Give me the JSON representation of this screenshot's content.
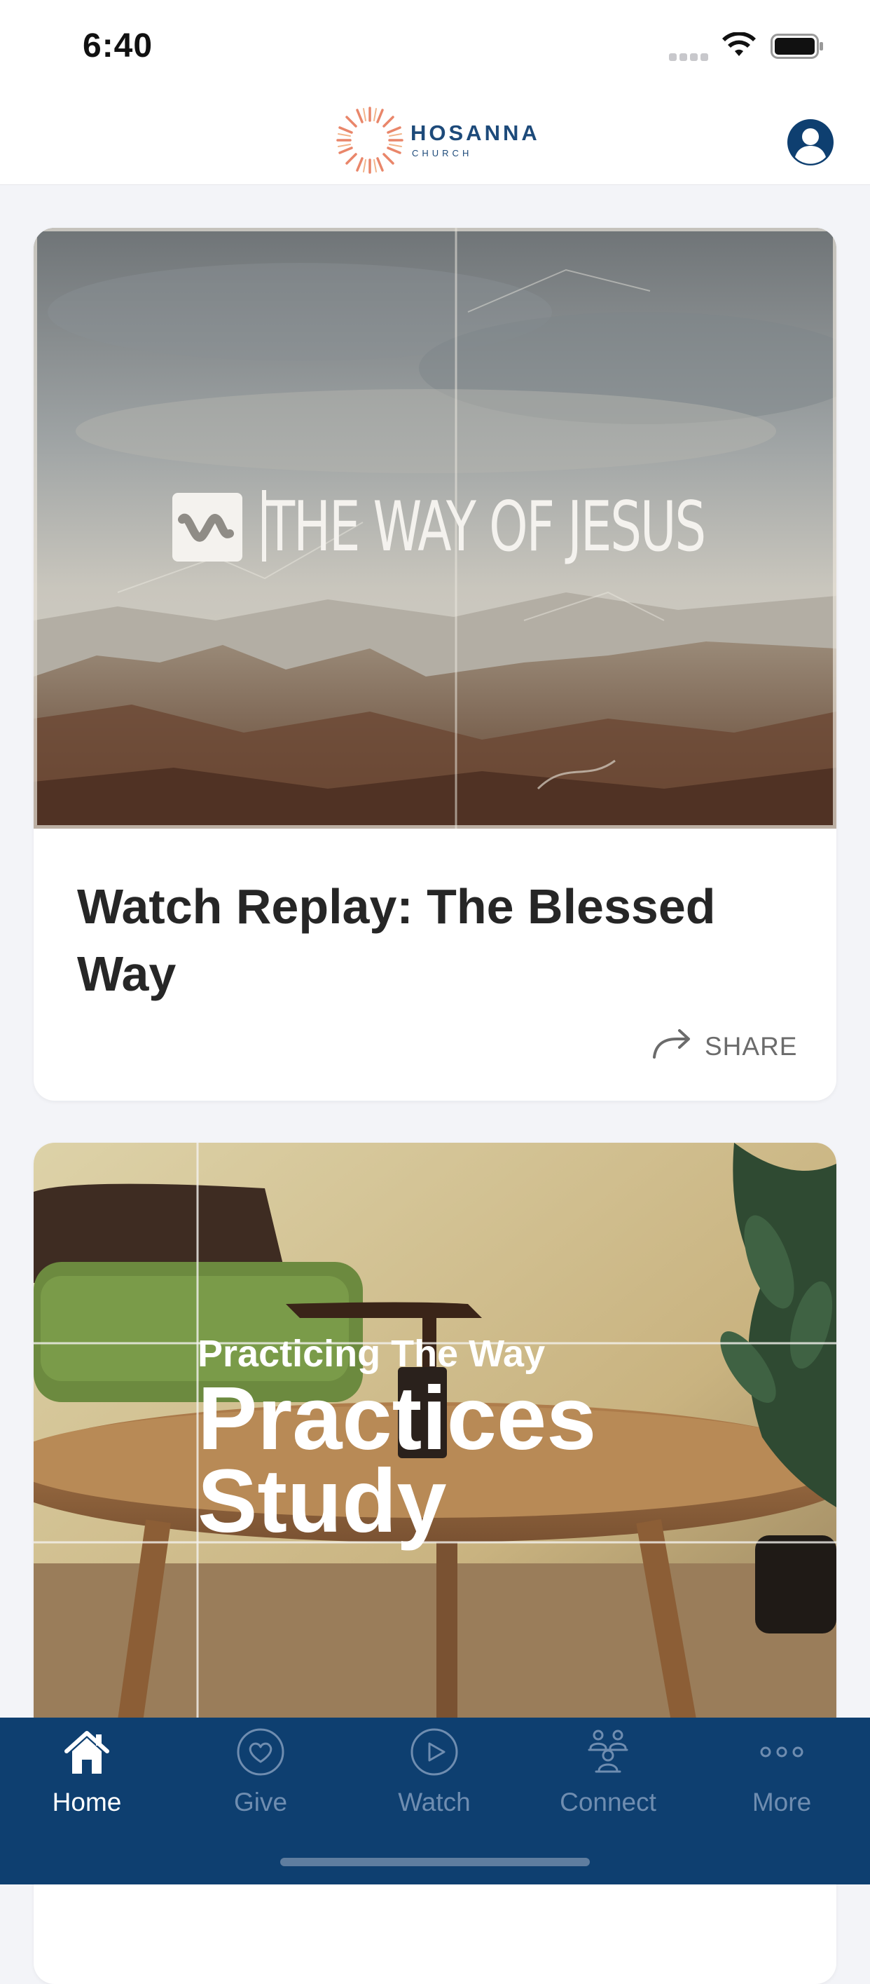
{
  "status_bar": {
    "time": "6:40"
  },
  "header": {
    "logo_name": "HOSANNA",
    "logo_sub": "CHURCH",
    "profile_icon": "person-circle-icon"
  },
  "cards": [
    {
      "series_title": "THE WAY OF JESUS",
      "title": "Watch Replay: The Blessed Way",
      "share_label": "SHARE"
    },
    {
      "eyebrow": "Practicing The Way",
      "title_line1": "Practices",
      "title_line2": "Study"
    }
  ],
  "tabs": [
    {
      "label": "Home",
      "icon": "home-icon",
      "active": true
    },
    {
      "label": "Give",
      "icon": "heart-circle-icon",
      "active": false
    },
    {
      "label": "Watch",
      "icon": "play-circle-icon",
      "active": false
    },
    {
      "label": "Connect",
      "icon": "people-icon",
      "active": false
    },
    {
      "label": "More",
      "icon": "more-dots-icon",
      "active": false
    }
  ],
  "colors": {
    "tab_bar": "#0e3f70",
    "tab_active": "#ffffff",
    "tab_inactive": "#6f8db0",
    "brand": "#1d4a7a",
    "logo_accent": "#e9866a"
  }
}
